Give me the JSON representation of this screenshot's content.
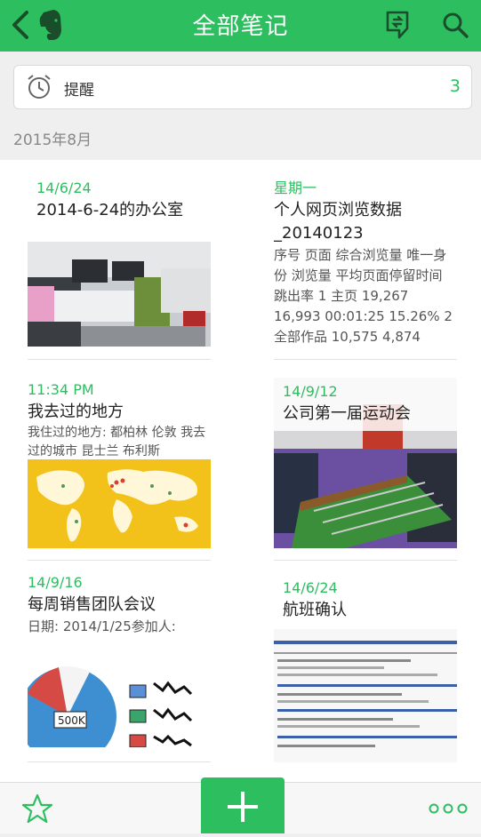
{
  "header": {
    "title": "全部笔记"
  },
  "reminder": {
    "label": "提醒",
    "count": "3"
  },
  "section": {
    "month": "2015年8月"
  },
  "notes": [
    {
      "date": "14/6/24",
      "title": "2014-6-24的办公室",
      "snippet": "",
      "thumb": "office-photo"
    },
    {
      "date": "星期一",
      "title": "个人网页浏览数据_20140123",
      "snippet": "序号 页面 综合浏览量 唯一身份 浏览量 平均页面停留时间 跳出率 1 主页 19,267 16,993 00:01:25 15.26% 2 全部作品 10,575 4,874",
      "thumb": ""
    },
    {
      "date": "11:34 PM",
      "title": "我去过的地方",
      "snippet": "我住过的地方: 都柏林 伦敦 我去过的城市 昆士兰 布利斯",
      "thumb": "world-map"
    },
    {
      "date": "14/9/12",
      "title": "公司第一届运动会",
      "snippet": "",
      "thumb": "foosball-photo"
    },
    {
      "date": "14/9/16",
      "title": "每周销售团队会议",
      "snippet": "日期: 2014/1/25参加人:",
      "thumb": "sales-chart-sketch"
    },
    {
      "date": "14/6/24",
      "title": "航班确认",
      "snippet": "",
      "thumb": "flight-document"
    }
  ],
  "icons": {
    "back": "chevron-left-icon",
    "logo": "elephant-logo-icon",
    "sync": "sync-icon",
    "search": "search-icon",
    "alarm": "alarm-clock-icon",
    "star": "star-icon",
    "add": "plus-icon",
    "more": "more-dots-icon"
  },
  "colors": {
    "accent": "#2dbe60",
    "background": "#efefef"
  }
}
